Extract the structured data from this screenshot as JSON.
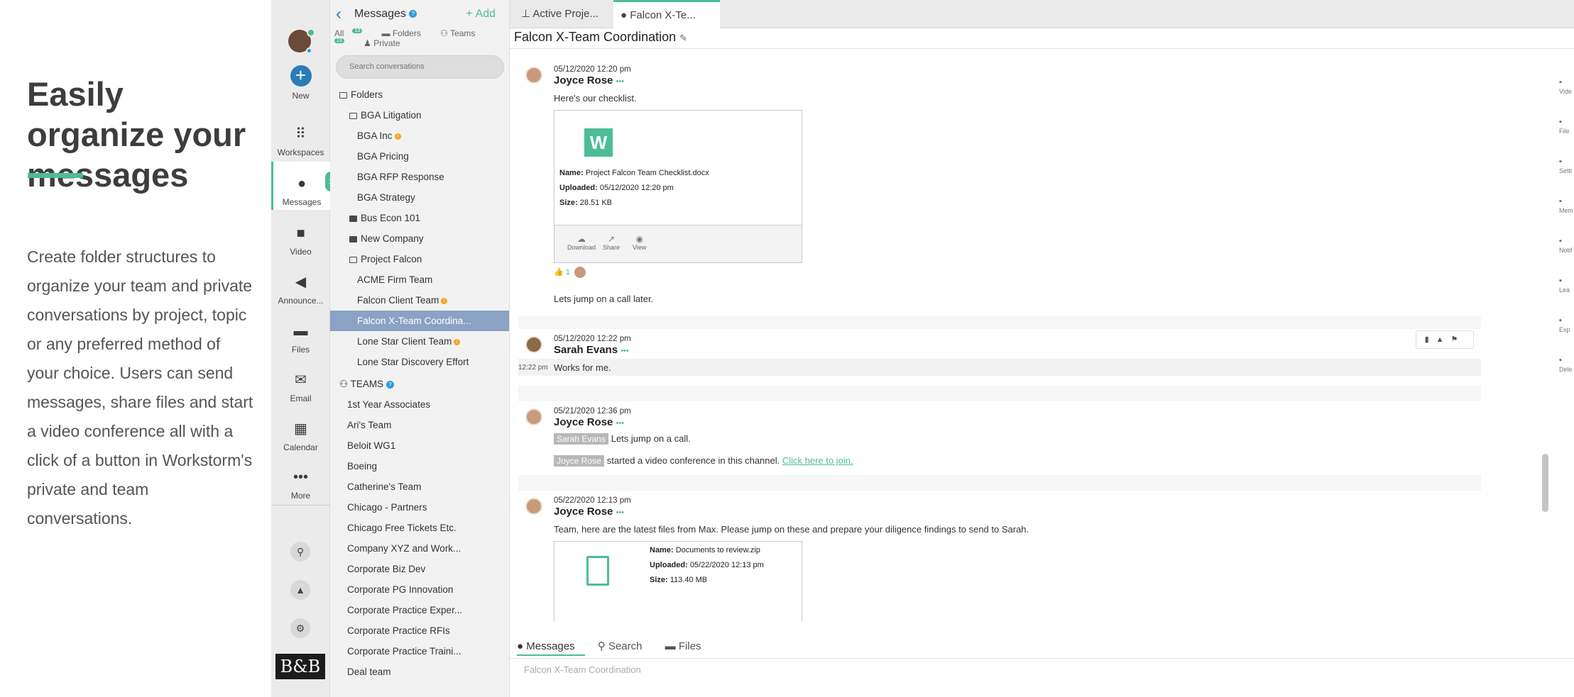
{
  "promo": {
    "headline": "Easily organize your messages",
    "body": "Create folder structures to organize your team and private conversations by project, topic or any preferred method of your choice. Users can send messages, share files and start a video conference all with a click of a button in Workstorm's private and team conversations."
  },
  "rail": {
    "items": [
      {
        "label": "New",
        "icon": "plus-icon"
      },
      {
        "label": "Workspaces",
        "icon": "grid-icon"
      },
      {
        "label": "Messages",
        "icon": "chat-icon",
        "badge": "13"
      },
      {
        "label": "Video",
        "icon": "video-icon"
      },
      {
        "label": "Announce...",
        "icon": "megaphone-icon"
      },
      {
        "label": "Files",
        "icon": "folder-icon"
      },
      {
        "label": "Email",
        "icon": "mail-icon"
      },
      {
        "label": "Calendar",
        "icon": "calendar-icon"
      },
      {
        "label": "More",
        "icon": "more-icon"
      }
    ],
    "logo": "B&B"
  },
  "list": {
    "title": "Messages",
    "add_label": "Add",
    "filters": {
      "all": "All",
      "all_badge": "13",
      "folders": "Folders",
      "teams": "Teams",
      "teams_badge": "13",
      "private": "Private"
    },
    "search_placeholder": "Search conversations",
    "folders_label": "Folders",
    "folders": [
      {
        "label": "BGA Litigation",
        "level": 1,
        "open": true
      },
      {
        "label": "BGA Inc",
        "level": 2,
        "badge": true
      },
      {
        "label": "BGA Pricing",
        "level": 2
      },
      {
        "label": "BGA RFP Response",
        "level": 2
      },
      {
        "label": "BGA Strategy",
        "level": 2
      },
      {
        "label": "Bus Econ 101",
        "level": 1
      },
      {
        "label": "New Company",
        "level": 1
      },
      {
        "label": "Project Falcon",
        "level": 1,
        "open": true
      },
      {
        "label": "ACME Firm Team",
        "level": 2
      },
      {
        "label": "Falcon Client Team",
        "level": 2,
        "badge": true
      },
      {
        "label": "Falcon X-Team Coordina...",
        "level": 2,
        "selected": true
      },
      {
        "label": "Lone Star Client Team",
        "level": 2,
        "badge": true
      },
      {
        "label": "Lone Star Discovery Effort",
        "level": 2
      }
    ],
    "teams_label": "TEAMS",
    "teams": [
      "1st Year Associates",
      "Ari's Team",
      "Beloit WG1",
      "Boeing",
      "Catherine's Team",
      "Chicago - Partners",
      "Chicago Free Tickets Etc.",
      "Company XYZ and Work...",
      "Corporate Biz Dev",
      "Corporate PG Innovation",
      "Corporate Practice Exper...",
      "Corporate Practice RFIs",
      "Corporate Practice Traini...",
      "Deal team"
    ]
  },
  "main": {
    "tabs": [
      "Active Proje...",
      "Falcon X-Te..."
    ],
    "channel_title": "Falcon X-Team Coordination",
    "messages": [
      {
        "timestamp": "05/12/2020 12:20 pm",
        "author": "Joyce Rose",
        "text": "Here's our checklist.",
        "file": {
          "name_label": "Name:",
          "name": "Project Falcon Team Checklist.docx",
          "uploaded_label": "Uploaded:",
          "uploaded": "05/12/2020 12:20 pm",
          "size_label": "Size:",
          "size": "28.51 KB",
          "icon_letter": "W"
        },
        "actions": [
          "Download",
          "Share",
          "View"
        ],
        "reaction_count": "1",
        "followup": "Lets jump on a call later."
      },
      {
        "timestamp": "05/12/2020 12:22 pm",
        "author": "Sarah Evans",
        "side_time": "12:22 pm",
        "text": "Works for me."
      },
      {
        "timestamp": "05/21/2020 12:36 pm",
        "author": "Joyce Rose",
        "mention1": "Sarah Evans",
        "text1": "Lets jump on a call.",
        "mention2": "Joyce Rose",
        "text2": "started a video conference in this channel.",
        "link": "Click here to join."
      },
      {
        "timestamp": "05/22/2020 12:13 pm",
        "author": "Joyce Rose",
        "text": "Team, here are the latest files from Max. Please jump on these and prepare your diligence findings to send to Sarah.",
        "file": {
          "name_label": "Name:",
          "name": "Documents to review.zip",
          "uploaded_label": "Uploaded:",
          "uploaded": "05/22/2020 12:13 pm",
          "size_label": "Size:",
          "size": "113.40 MB"
        }
      }
    ],
    "bottom_tabs": [
      "Messages",
      "Search",
      "Files"
    ],
    "composer_placeholder": "Falcon X-Team Coordination",
    "right_sidebar": [
      "Vide",
      "File",
      "Setti",
      "Mem",
      "Notif",
      "Lea",
      "Exp",
      "Dele"
    ]
  },
  "colors": {
    "accent": "#4dbd96",
    "selected_row": "#8aa2c4",
    "link_blue": "#2a7db8"
  }
}
